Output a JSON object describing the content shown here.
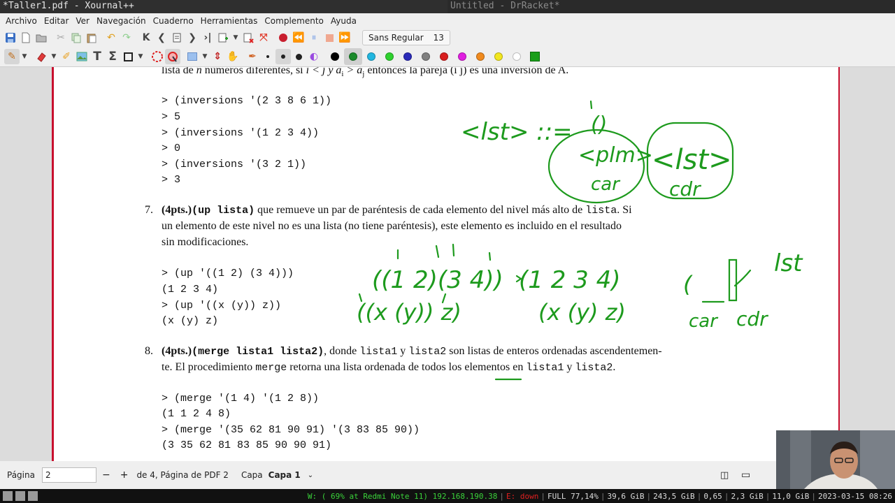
{
  "window": {
    "left_title": "*Taller1.pdf - Xournal++",
    "right_title": "Untitled - DrRacket*"
  },
  "menu": [
    "Archivo",
    "Editar",
    "Ver",
    "Navegación",
    "Cuaderno",
    "Herramientas",
    "Complemento",
    "Ayuda"
  ],
  "font_selector": {
    "name": "Sans Regular",
    "size": "13"
  },
  "toolbar2_colors": [
    "#000000",
    "#1a8a2a",
    "#21b6e0",
    "#2ed12e",
    "#2a2ab8",
    "#808080",
    "#d81e1e",
    "#e01ee0",
    "#f08a1e",
    "#f2e61e",
    "#ffffff",
    "#1a9e1a"
  ],
  "document": {
    "intro_line_prefix": "lista de",
    "intro_n": "n",
    "intro_middle": "números diferentes, si",
    "intro_math": "i < j y a",
    "intro_sub_i": "i",
    "intro_gt": " > a",
    "intro_sub_j": "j",
    "intro_suffix": "entonces la pareja (i j) es una inversión de A.",
    "inversions_code": [
      "> (inversions '(2 3 8 6 1))",
      "> 5",
      "> (inversions '(1 2 3 4))",
      "> 0",
      "> (inversions '(3 2 1))",
      "> 3"
    ],
    "item7": {
      "number": "7.",
      "pts": "(4pts.)",
      "fname": "(up lista)",
      "line1_rest": "que remueve un par de paréntesis de cada elemento del nivel más alto de",
      "line1_code": "lista",
      "line1_end": ". Si",
      "line2": "un elemento de este nivel no es una lista (no tiene paréntesis), este elemento es incluido en el resultado",
      "line3": "sin modificaciones.",
      "code": [
        "> (up '((1 2) (3 4)))",
        "(1 2 3 4)",
        "> (up '((x (y)) z))",
        "(x (y) z)"
      ]
    },
    "item8": {
      "number": "8.",
      "pts": "(4pts.)",
      "fname": "(merge lista1 lista2)",
      "line1_a": ", donde",
      "line1_c1": "lista1",
      "line1_b": "y",
      "line1_c2": "lista2",
      "line1_c": "son listas de enteros ordenadas ascendentemen-",
      "line2_a": "te. El procedimiento",
      "line2_c1": "merge",
      "line2_b": "retorna una lista ordenada de todos los elementos en",
      "line2_c2": "lista1",
      "line2_y": "y",
      "line2_c3": "lista2",
      "line2_end": ".",
      "code": [
        "> (merge '(1 4) '(1 2 8))",
        "(1 1 2 4 8)",
        "> (merge '(35 62 81 90 91) '(3 83 85 90))",
        "(3 35 62 81 83 85 90 90 91)"
      ]
    }
  },
  "annotations": {
    "lst_def": "<lst> ::=",
    "empty": "()",
    "plm": "<plm>",
    "lst": "<lst>",
    "car1": "car",
    "cdr1": "cdr",
    "ex1_left": "((1 2)(3 4))",
    "ex1_right": "(1 2 3 4)",
    "ex2_left": "((x (y)) z)",
    "ex2_right": "(x (y) z)",
    "lst2": "lst",
    "car2": "car",
    "cdr2": "cdr",
    "ink_color": "#1d9a1d"
  },
  "statusbar": {
    "page_label": "Página",
    "page_value": "2",
    "minus": "−",
    "plus": "+",
    "page_info": "de 4, Página de PDF 2",
    "layer_label": "Capa",
    "layer_value": "Capa 1"
  },
  "taskbar": {
    "wifi": "W: ( 69% at Redmi Note 11) 192.168.190.38",
    "eth": "E: down",
    "battery": "FULL 77,14%",
    "disk1": "39,6 GiB",
    "disk2": "243,5 GiB",
    "load": "0,65",
    "mem1": "2,3 GiB",
    "mem2": "11,0 GiB",
    "datetime": "2023-03-15 08:26"
  }
}
